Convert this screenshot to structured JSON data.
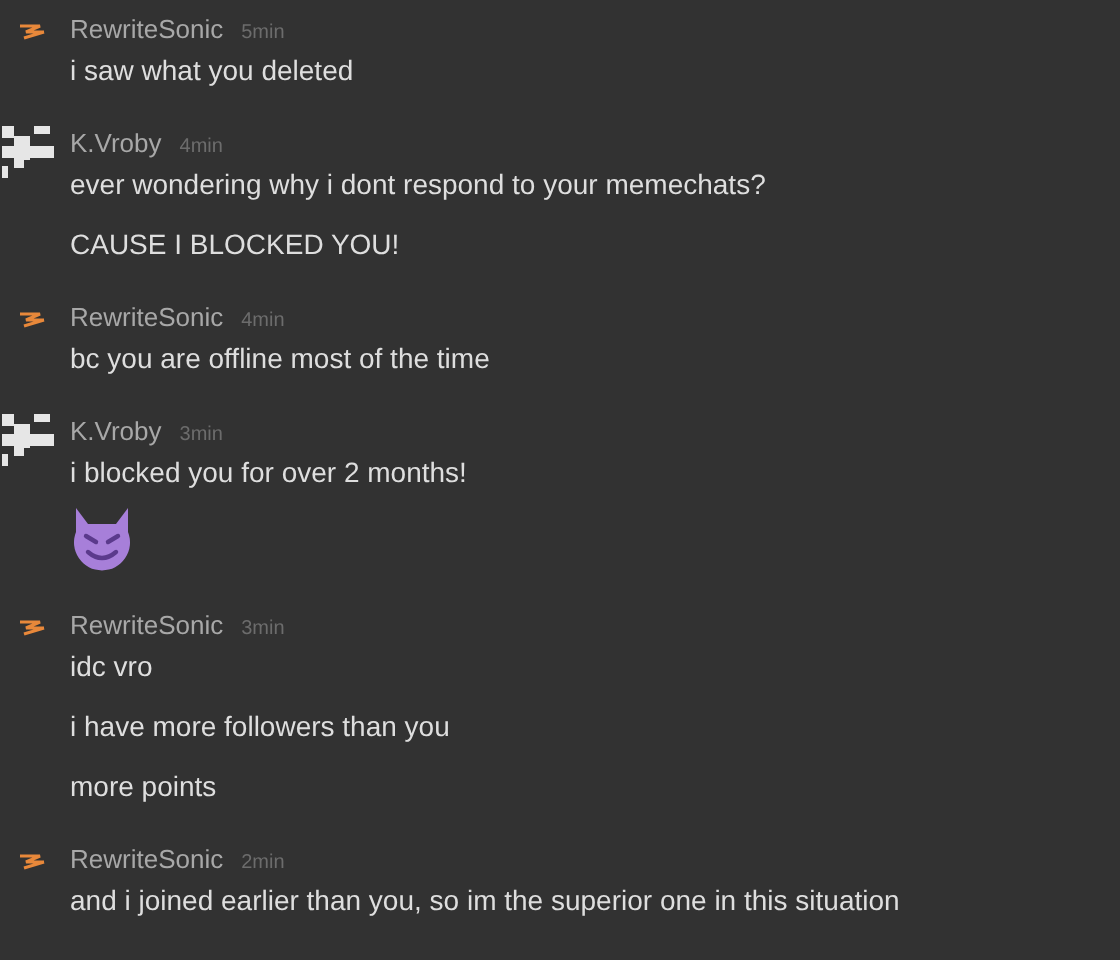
{
  "messages": [
    {
      "author": "RewriteSonic",
      "avatar": {
        "kind": "bolt"
      },
      "time": "5min",
      "lines": [
        {
          "kind": "text",
          "text": "i saw what you deleted"
        }
      ]
    },
    {
      "author": "K.Vroby",
      "avatar": {
        "kind": "pixel"
      },
      "time": "4min",
      "lines": [
        {
          "kind": "text",
          "text": "ever wondering why i dont respond to your memechats?"
        },
        {
          "kind": "text",
          "text": "CAUSE I BLOCKED YOU!"
        }
      ]
    },
    {
      "author": "RewriteSonic",
      "avatar": {
        "kind": "bolt"
      },
      "time": "4min",
      "lines": [
        {
          "kind": "text",
          "text": "bc you are offline most of the time"
        }
      ]
    },
    {
      "author": "K.Vroby",
      "avatar": {
        "kind": "pixel"
      },
      "time": "3min",
      "lines": [
        {
          "kind": "text",
          "text": "i blocked you for over 2 months!"
        },
        {
          "kind": "emoji"
        }
      ]
    },
    {
      "author": "RewriteSonic",
      "avatar": {
        "kind": "bolt"
      },
      "time": "3min",
      "lines": [
        {
          "kind": "text",
          "text": "idc vro"
        },
        {
          "kind": "text",
          "text": "i have more followers than you"
        },
        {
          "kind": "text",
          "text": "more points"
        }
      ]
    },
    {
      "author": "RewriteSonic",
      "avatar": {
        "kind": "bolt"
      },
      "time": "2min",
      "lines": [
        {
          "kind": "text",
          "text": "and i joined earlier than you, so im the superior one in this situation"
        }
      ]
    }
  ]
}
